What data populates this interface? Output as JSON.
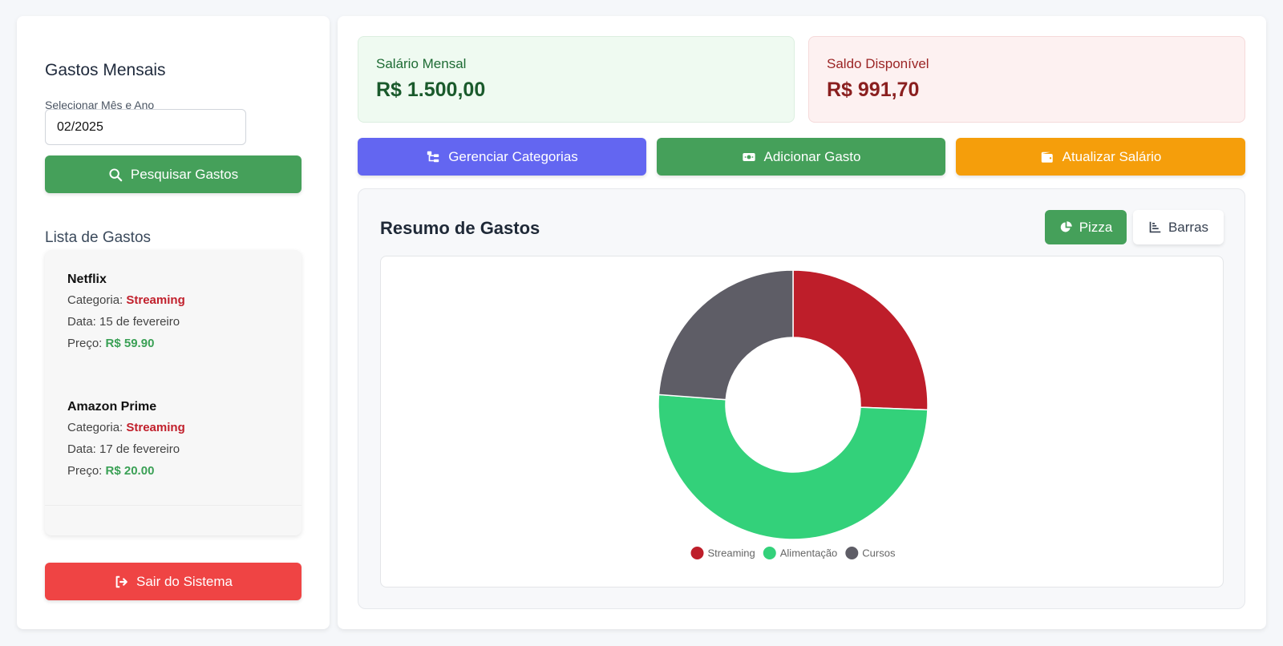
{
  "sidebar": {
    "title": "Gastos Mensais",
    "select_label": "Selecionar Mês e Ano",
    "month_value": "02/2025",
    "search_label": "Pesquisar Gastos",
    "list_title": "Lista de Gastos",
    "items": [
      {
        "name": "Netflix",
        "category_prefix": "Categoria: ",
        "category": "Streaming",
        "date": "Data: 15 de fevereiro",
        "price_prefix": "Preço: ",
        "price": "R$ 59.90"
      },
      {
        "name": "Amazon Prime",
        "category_prefix": "Categoria: ",
        "category": "Streaming",
        "date": "Data: 17 de fevereiro",
        "price_prefix": "Preço: ",
        "price": "R$ 20.00"
      }
    ],
    "logout_label": "Sair do Sistema"
  },
  "cards": {
    "salary_label": "Salário Mensal",
    "salary_value": "R$ 1.500,00",
    "balance_label": "Saldo Disponível",
    "balance_value": "R$ 991,70"
  },
  "actions": {
    "categories_label": "Gerenciar Categorias",
    "add_label": "Adicionar Gasto",
    "update_label": "Atualizar Salário"
  },
  "summary": {
    "title": "Resumo de Gastos",
    "pizza_label": "Pizza",
    "bars_label": "Barras"
  },
  "icons": {
    "search": "search-icon",
    "logout": "sign-out-icon",
    "categories": "sitemap-icon",
    "add": "money-bill-icon",
    "update": "wallet-icon",
    "pizza": "chart-pie-icon",
    "bars": "chart-bar-icon"
  },
  "colors": {
    "primary_green": "#45a05a",
    "indigo": "#6366f1",
    "amber": "#f59e0b",
    "danger": "#ef4444",
    "category_text": "#c1202c",
    "price_text": "#3aa055"
  },
  "chart_data": {
    "type": "pie",
    "variant": "doughnut",
    "categories": [
      "Streaming",
      "Alimentação",
      "Cursos"
    ],
    "values": [
      25.6,
      50.6,
      23.8
    ],
    "colors": [
      "#be1e2a",
      "#33d17a",
      "#5e5d66"
    ],
    "legend_position": "bottom"
  }
}
